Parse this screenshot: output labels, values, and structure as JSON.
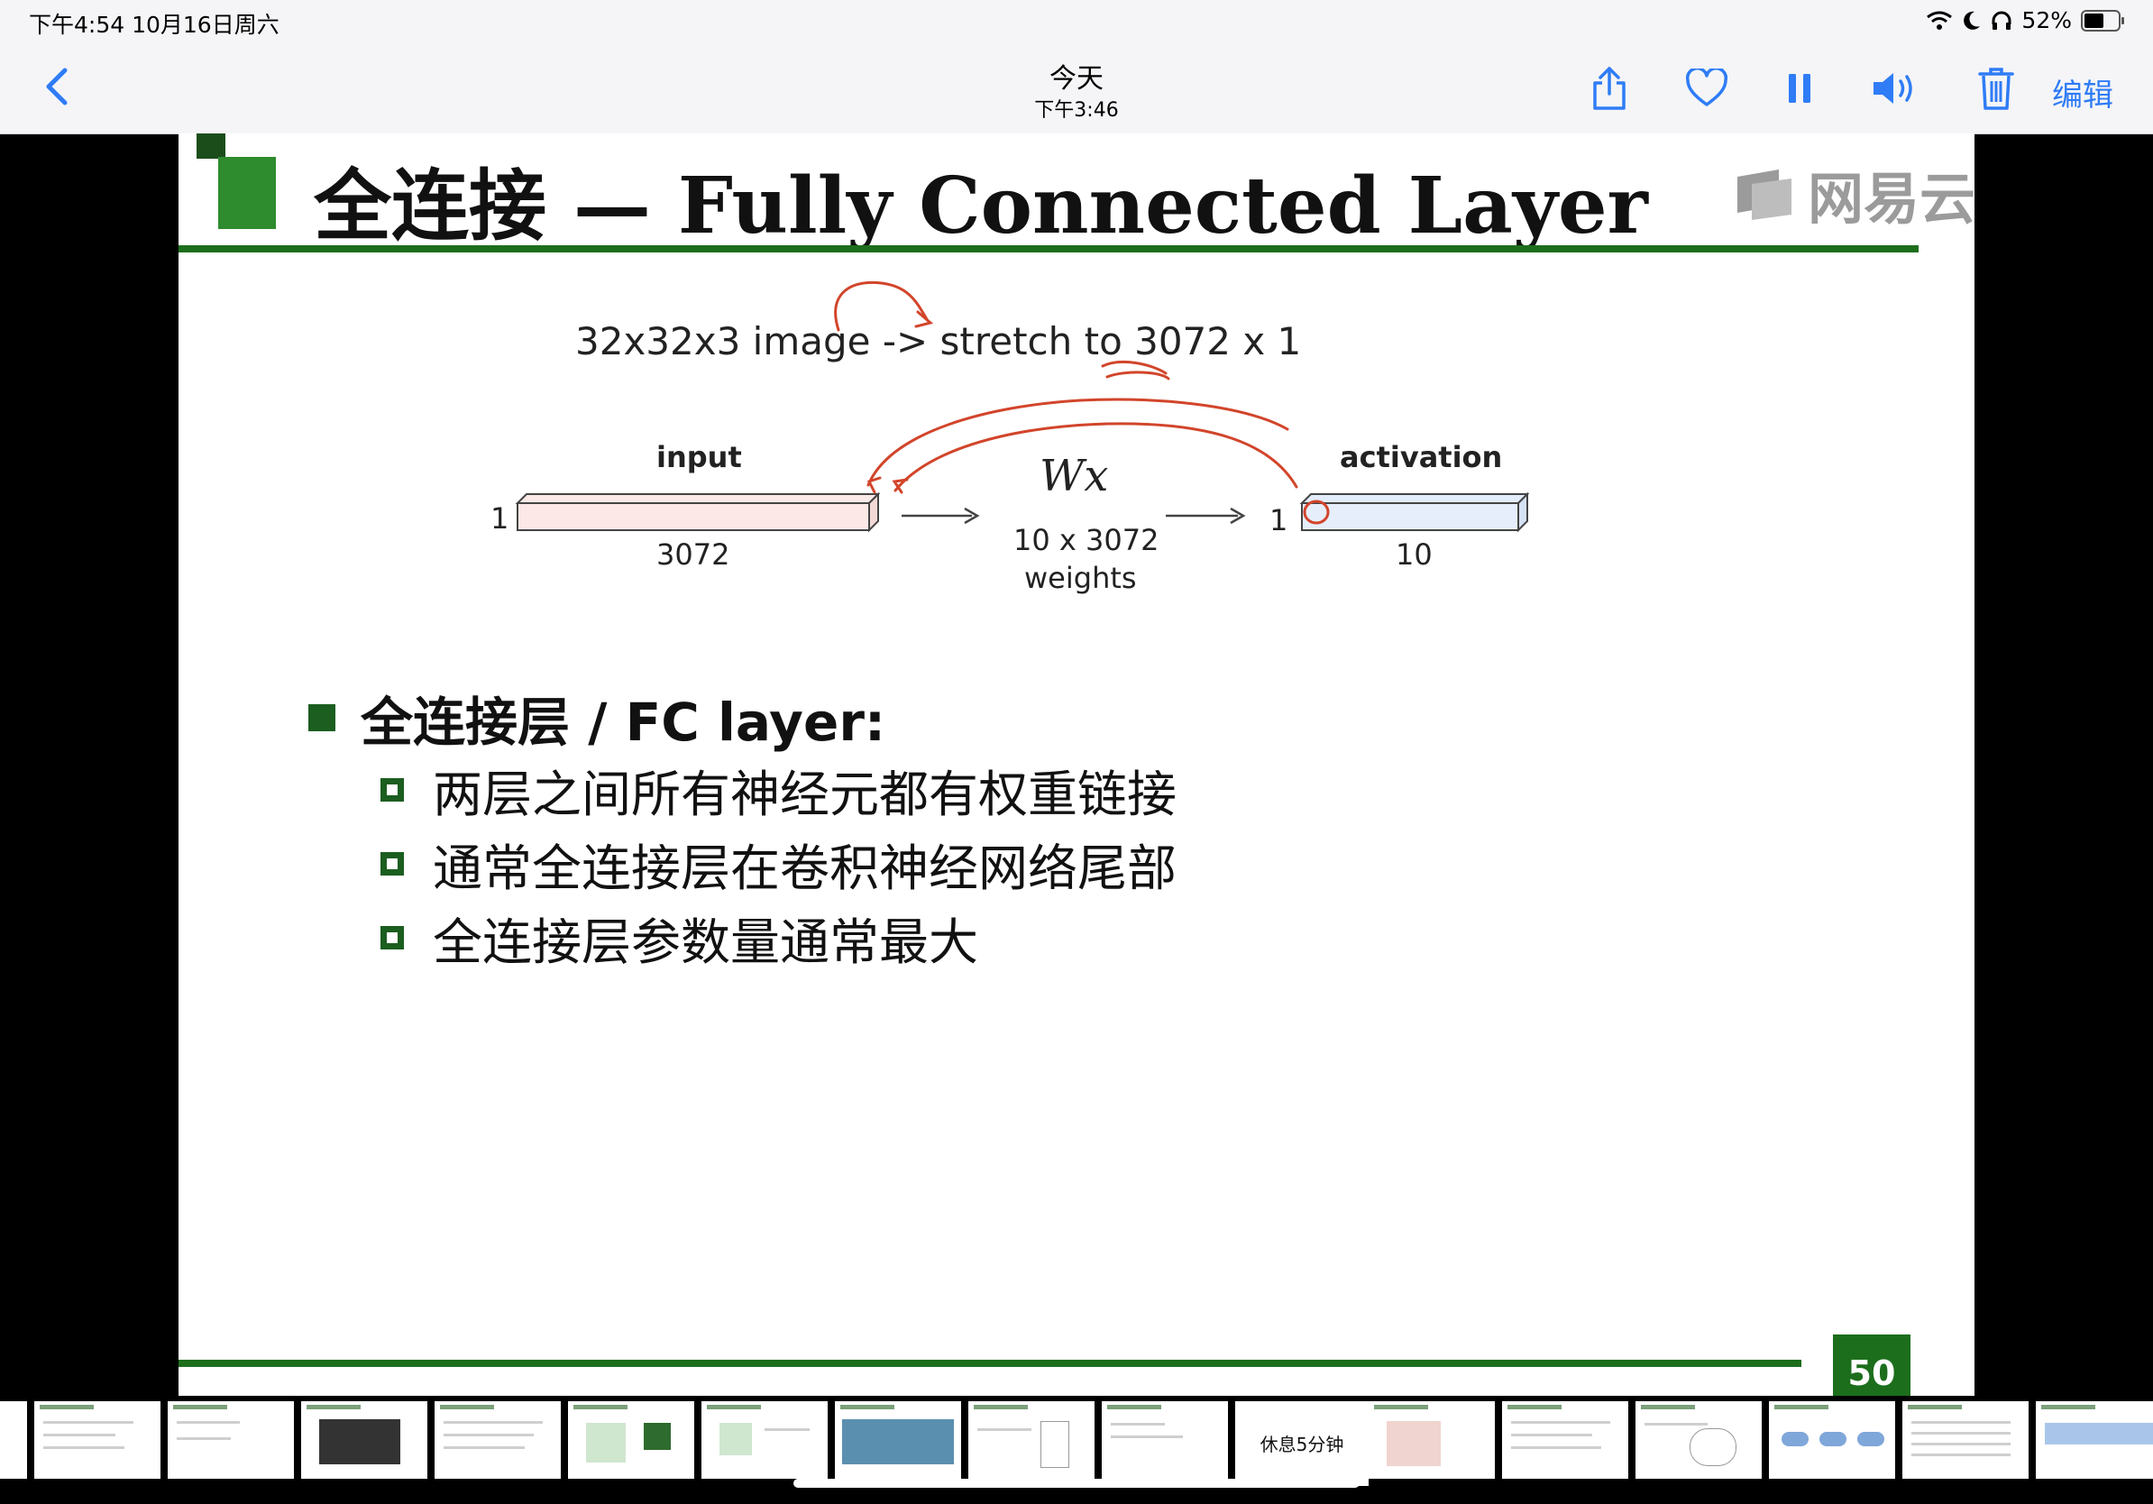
{
  "status": {
    "time_date": "下午4:54   10月16日周六",
    "battery": "52%"
  },
  "nav": {
    "title": "今天",
    "subtitle": "下午3:46",
    "edit": "编辑"
  },
  "slide": {
    "title": "全连接 — Fully Connected Layer",
    "logo": "网易云",
    "stretch": "32x32x3 image -> stretch to 3072 x 1",
    "input_label": "input",
    "activation_label": "activation",
    "input_height": "1",
    "input_width": "3072",
    "output_height": "1",
    "output_width": "10",
    "wx": "Wx",
    "weights_dim": "10 x 3072",
    "weights_word": "weights",
    "bullet": "全连接层 / FC layer:",
    "sub_bullets": [
      "两层之间所有神经元都有权重链接",
      "通常全连接层在卷积神经网络尾部",
      "全连接层参数量通常最大"
    ],
    "page_number": "50"
  },
  "thumbs": {
    "rest_slide": "休息5分钟"
  },
  "colors": {
    "accent_green": "#1c6e1c",
    "ios_blue": "#2f7cf6",
    "annotation_red": "#d2452b"
  }
}
